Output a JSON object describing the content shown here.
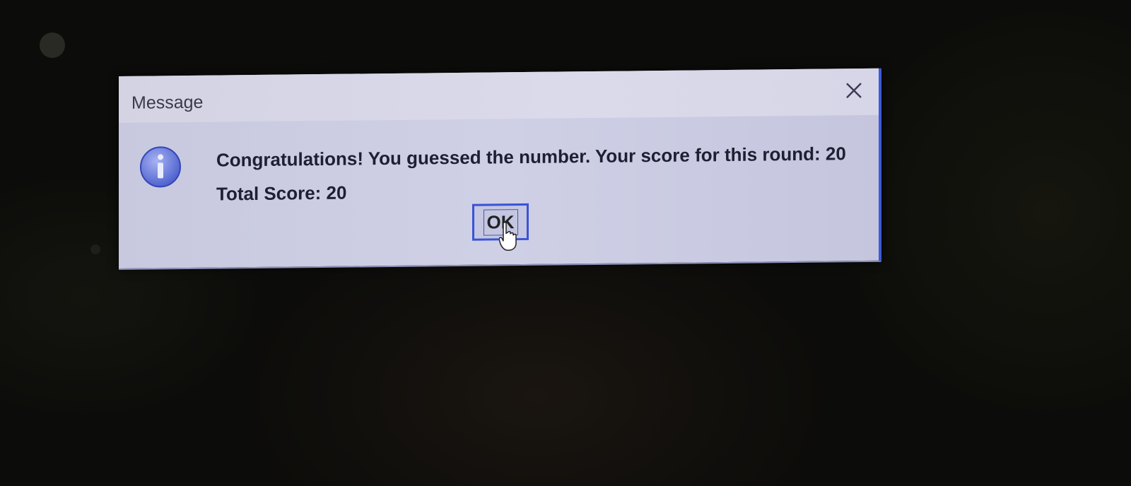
{
  "dialog": {
    "title": "Message",
    "message_line1": "Congratulations! You guessed the number. Your score for this round: 20",
    "message_line2": "Total Score: 20",
    "ok_label": "OK"
  },
  "icons": {
    "close": "close-icon",
    "info": "info-icon",
    "cursor": "hand-cursor-icon"
  },
  "colors": {
    "accent_border": "#3f5bd6",
    "dialog_bg": "#cfd0e6",
    "info_icon": "#5a6fd8"
  }
}
